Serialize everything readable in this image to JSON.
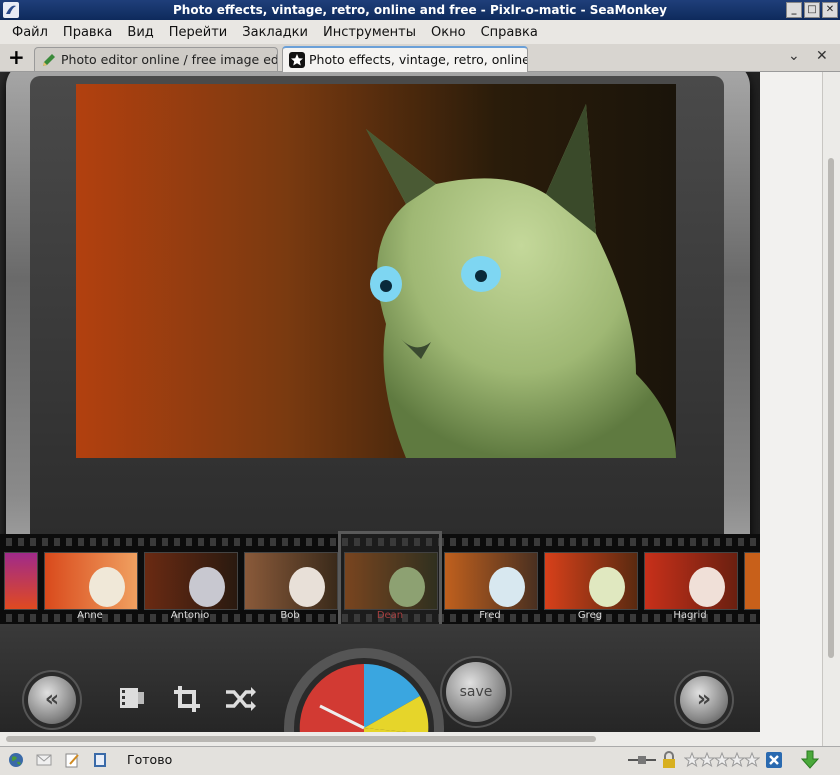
{
  "window": {
    "title": "Photo effects, vintage, retro, online and free - Pixlr-o-matic - SeaMonkey",
    "buttons": [
      "_",
      "□",
      "✕"
    ]
  },
  "menubar": {
    "items": [
      "Файл",
      "Правка",
      "Вид",
      "Перейти",
      "Закладки",
      "Инструменты",
      "Окно",
      "Справка"
    ]
  },
  "tabs": [
    {
      "label": "Photo editor online / free image edi...",
      "active": false
    },
    {
      "label": "Photo effects, vintage, retro, online ...",
      "active": true
    }
  ],
  "tab_controls": {
    "new_tab": "+",
    "list": "⌄",
    "close": "✕"
  },
  "filters": {
    "selected": "Dean",
    "items": [
      {
        "name": "Anne",
        "tint": "#d94a1c"
      },
      {
        "name": "Antonio",
        "tint": "#5a2a14"
      },
      {
        "name": "Bob",
        "tint": "#7a4a2a"
      },
      {
        "name": "Dean",
        "tint": "#8a4a10"
      },
      {
        "name": "Fred",
        "tint": "#b05a20"
      },
      {
        "name": "Greg",
        "tint": "#c8401a"
      },
      {
        "name": "Hagrid",
        "tint": "#b82a14"
      }
    ]
  },
  "controls": {
    "prev": "«",
    "next": "»",
    "save": "save"
  },
  "status": {
    "text": "Готово"
  },
  "colors": {
    "title_bar": "#173366",
    "accent_selected": "#e04040",
    "dial_red": "#d23a33",
    "dial_blue": "#3aa6e0",
    "dial_yellow": "#e6d52a"
  }
}
